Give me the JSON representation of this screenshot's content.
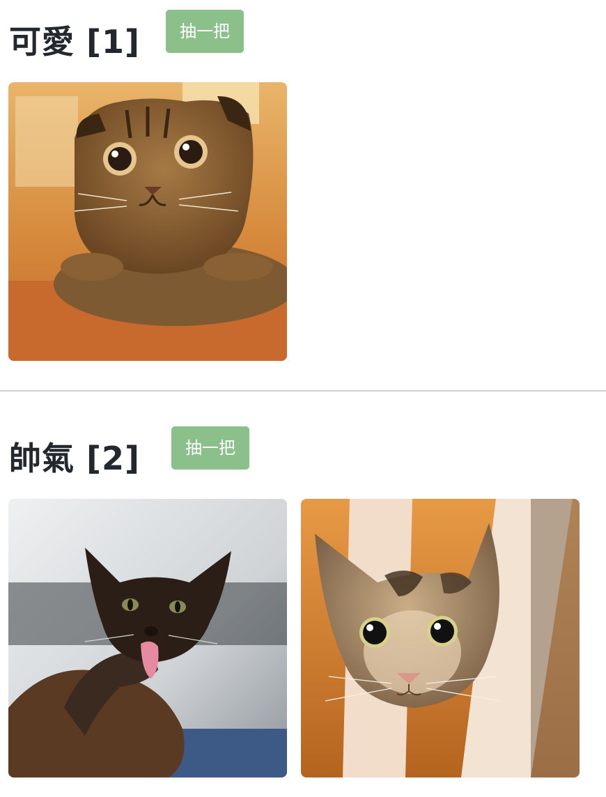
{
  "sections": [
    {
      "title": "可愛 [1]",
      "button_label": "抽一把",
      "photos": [
        {
          "description_icon": "cat-photo",
          "palette": {
            "bg": "#c46a2c",
            "top": "#e9b56a",
            "fur": "#8a6134",
            "stripe": "#3b2613",
            "eye": "#2a1c10"
          }
        }
      ]
    },
    {
      "title": "帥氣 [2]",
      "button_label": "抽一把",
      "photos": [
        {
          "description_icon": "cat-photo",
          "palette": {
            "bg": "#cfd3d6",
            "floor": "#3d5a86",
            "fur": "#2b1e17",
            "tongue": "#e58aa0"
          }
        },
        {
          "description_icon": "cat-photo",
          "palette": {
            "bg": "#d98a35",
            "wood": "#f1ddc9",
            "fur": "#a68c6c",
            "eye": "#111111",
            "iris": "#d6d28b"
          }
        }
      ]
    }
  ]
}
